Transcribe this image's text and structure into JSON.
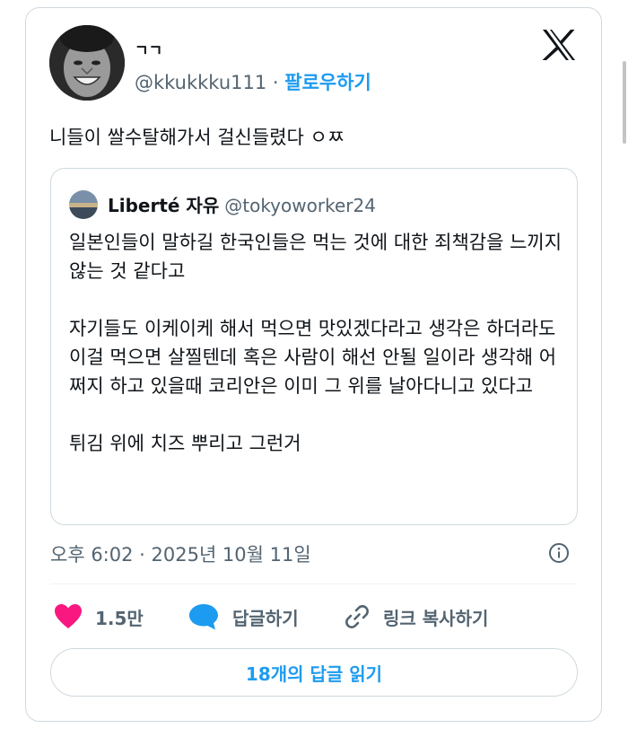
{
  "tweet": {
    "display_name": "ㄱㄱ",
    "handle": "@kkukkku111",
    "separator": " · ",
    "follow_label": "팔로우하기",
    "text": "니들이 쌀수탈해가서 걸신들렸다 ㅇㅉ",
    "timestamp": "오후 6:02 · 2025년 10월 11일"
  },
  "quote": {
    "display_name": "Liberté 자유",
    "handle": "@tokyoworker24",
    "paragraphs": [
      "일본인들이 말하길 한국인들은 먹는 것에 대한 죄책감을 느끼지 않는 것 같다고",
      "자기들도 이케이케 해서 먹으면 맛있겠다라고 생각은 하더라도 이걸 먹으면 살찔텐데 혹은 사람이 해선 안될 일이라 생각해 어쩌지 하고 있을때 코리안은 이미 그 위를 날아다니고 있다고",
      "튀김 위에 치즈 뿌리고 그런거"
    ]
  },
  "actions": {
    "like_count": "1.5만",
    "reply_label": "답글하기",
    "copy_link_label": "링크 복사하기"
  },
  "read_replies_label": "18개의 답글 읽기",
  "colors": {
    "accent": "#1d9bf0",
    "like": "#f91880",
    "muted": "#536471",
    "border": "#cfd9de"
  },
  "icons": {
    "brand": "x-logo-icon",
    "info": "info-icon",
    "like": "heart-icon",
    "reply": "speech-bubble-icon",
    "copy": "link-icon"
  }
}
